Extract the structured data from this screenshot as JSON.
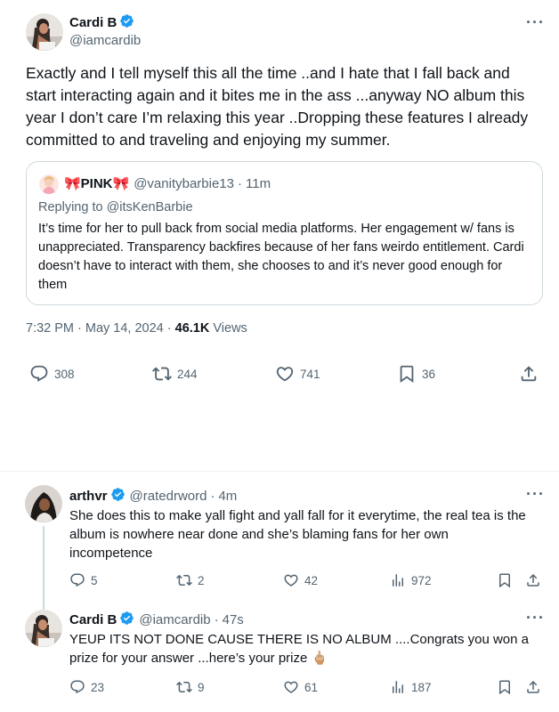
{
  "main_tweet": {
    "author": {
      "name": "Cardi B",
      "handle": "@iamcardib"
    },
    "text": "Exactly and I tell myself this all the time ..and I hate that I fall back and start interacting again and it bites me in the ass ...anyway NO album this year I don’t care I’m relaxing this year ..Dropping these features I already committed to and traveling and enjoying my summer.",
    "quote": {
      "name": "🎀PINK🎀",
      "handle": "@vanitybarbie13",
      "time": "11m",
      "replying_to": "Replying to @itsKenBarbie",
      "text": "It’s time for her to pull back from social media platforms. Her engagement w/ fans is unappreciated. Transparency backfires because of her fans weirdo entitlement. Cardi doesn’t have to interact with them, she chooses to and it’s never good enough for them"
    },
    "timestamp": "7:32 PM · May 14, 2024",
    "views_count": "46.1K",
    "views_label": "Views",
    "stats": {
      "replies": "308",
      "reposts": "244",
      "likes": "741",
      "bookmarks": "36"
    }
  },
  "replies": [
    {
      "name": "arthvr",
      "handle": "@ratedrword",
      "time": "4m",
      "text": "She does this to make yall fight and yall fall for it everytime, the real tea is the album is nowhere near done and she’s blaming fans for her own incompetence",
      "stats": {
        "replies": "5",
        "reposts": "2",
        "likes": "42",
        "views": "972"
      }
    },
    {
      "name": "Cardi B",
      "handle": "@iamcardib",
      "time": "47s",
      "text": "YEUP ITS NOT DONE CAUSE THERE IS NO ALBUM ....Congrats you won a prize for your answer ...here’s your prize 🖕🏼",
      "stats": {
        "replies": "23",
        "reposts": "9",
        "likes": "61",
        "views": "187"
      }
    }
  ],
  "colors": {
    "text": "#0f1419",
    "secondary": "#536471",
    "verified": "#1d9bf0",
    "border": "#cfd9de"
  }
}
